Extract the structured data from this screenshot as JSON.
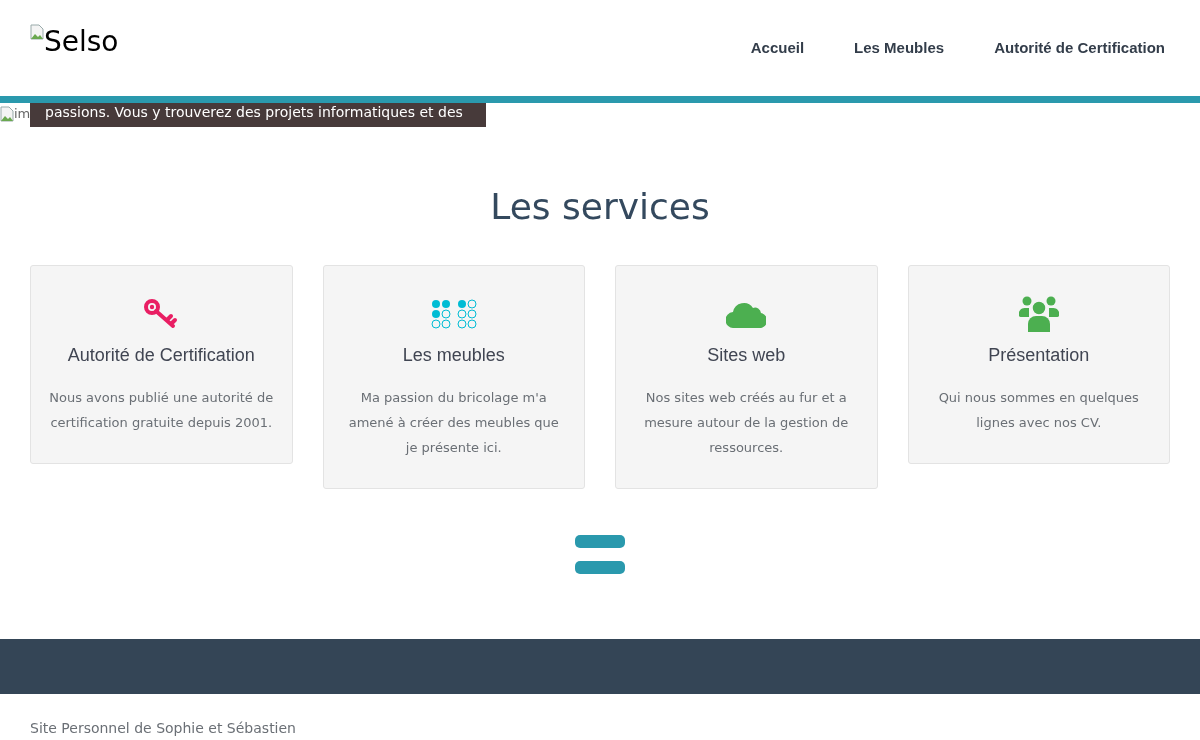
{
  "header": {
    "logo_alt": "Selso",
    "nav": [
      "Accueil",
      "Les Meubles",
      "Autorité de Certification"
    ]
  },
  "hero": {
    "image_alt": "im",
    "caption": "passions. Vous y trouverez des projets informatiques et des"
  },
  "services": {
    "title": "Les services",
    "items": [
      {
        "kind": "key",
        "title": "Autorité de Certification",
        "text": "Nous avons publié une autorité de certification gratuite depuis 2001."
      },
      {
        "kind": "dots",
        "title": "Les meubles",
        "text": "Ma passion du bricolage m'a amené à créer des meubles que je présente ici."
      },
      {
        "kind": "cloud",
        "title": "Sites web",
        "text": "Nos sites web créés au fur et a mesure autour de la gestion de ressources."
      },
      {
        "kind": "users",
        "title": "Présentation",
        "text": "Qui nous sommes en quelques lignes avec nos CV."
      }
    ]
  },
  "footer": {
    "text": "Site Personnel de Sophie et Sébastien"
  }
}
